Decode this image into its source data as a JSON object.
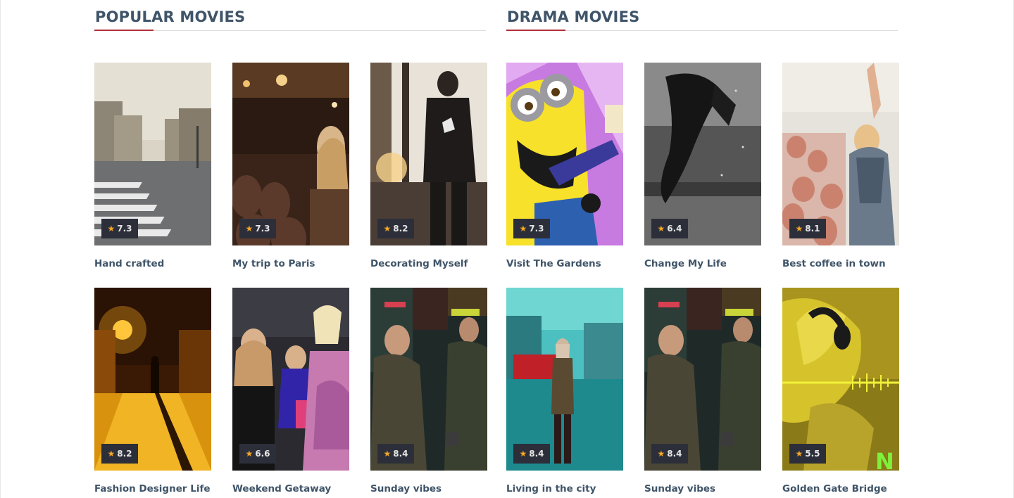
{
  "sections": {
    "popular": {
      "title": "POPULAR MOVIES",
      "movies": [
        {
          "title": "Hand crafted",
          "rating": "7.3",
          "poster": "paris-street-crosswalk"
        },
        {
          "title": "My trip to Paris",
          "rating": "7.3",
          "poster": "woman-in-theater"
        },
        {
          "title": "Decorating Myself",
          "rating": "8.2",
          "poster": "man-street-sunset"
        },
        {
          "title": "Fashion Designer Life",
          "rating": "8.2",
          "poster": "woman-night-alley"
        },
        {
          "title": "Weekend Getaway",
          "rating": "6.6",
          "poster": "red-carpet-women"
        },
        {
          "title": "Sunday vibes",
          "rating": "8.4",
          "poster": "two-men-street"
        }
      ]
    },
    "drama": {
      "title": "DRAMA MOVIES",
      "movies": [
        {
          "title": "Visit The Gardens",
          "rating": "7.3",
          "poster": "minion-cartoon"
        },
        {
          "title": "Change My Life",
          "rating": "6.4",
          "poster": "underwater-bw"
        },
        {
          "title": "Best coffee in town",
          "rating": "8.1",
          "poster": "concert-crowd"
        },
        {
          "title": "Living in the city",
          "rating": "8.4",
          "poster": "woman-london-street"
        },
        {
          "title": "Sunday vibes",
          "rating": "8.4",
          "poster": "two-men-street"
        },
        {
          "title": "Golden Gate Bridge",
          "rating": "5.5",
          "poster": "anime-headphones"
        }
      ]
    }
  },
  "colors": {
    "accent": "#b3303a",
    "heading": "#3f5468",
    "rating_bg": "#2c2f3a",
    "star": "#f5a623"
  },
  "icons": {
    "rating": "star-icon"
  }
}
